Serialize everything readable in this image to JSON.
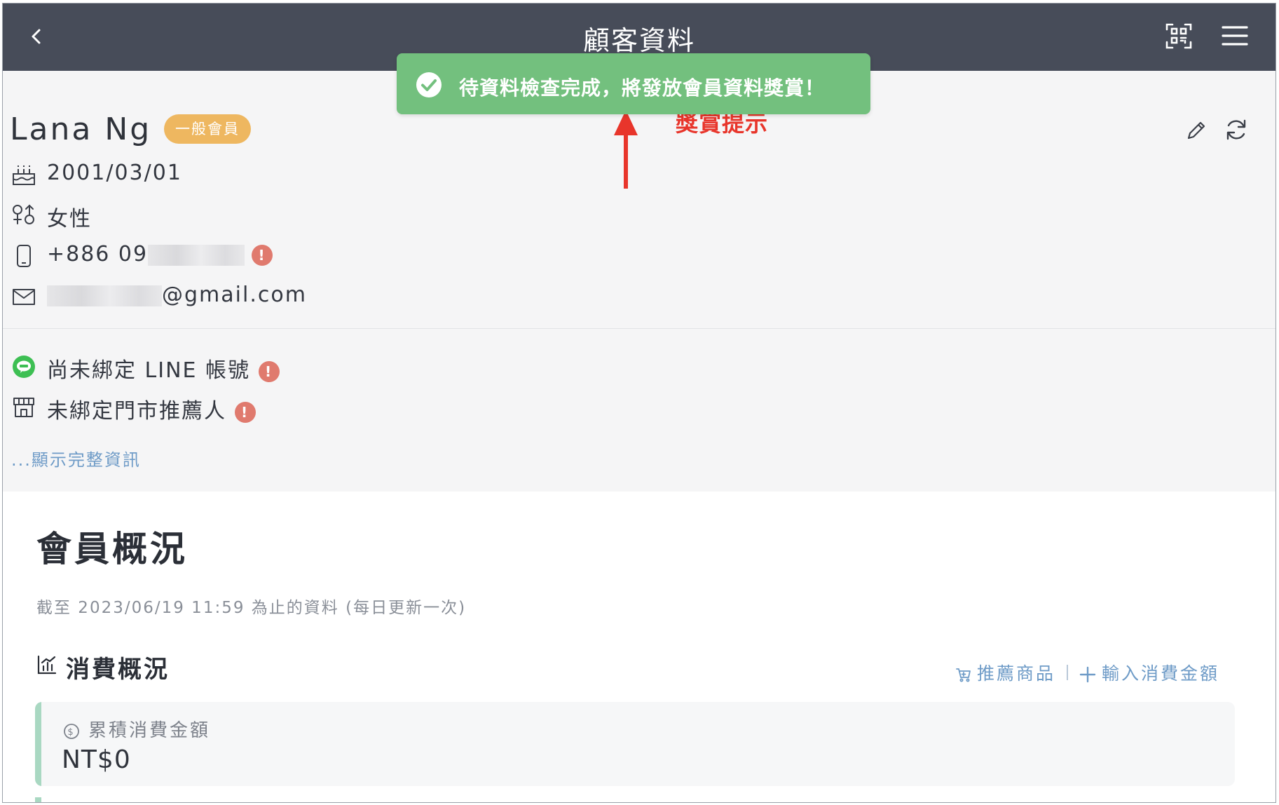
{
  "header": {
    "title": "顧客資料"
  },
  "toast": {
    "message": "待資料檢查完成，將發放會員資料獎賞！",
    "color": "#73c07e"
  },
  "annotation": {
    "label": "獎賞提示",
    "color": "#e8352b"
  },
  "profile": {
    "name": "Lana Ng",
    "badge": "一般會員",
    "birthday": "2001/03/01",
    "gender": "女性",
    "phone_prefix": "+886 09",
    "email_suffix": "@gmail.com",
    "line_status": "尚未綁定 LINE 帳號",
    "store_referrer": "未綁定門市推薦人",
    "show_more": "...顯示完整資訊",
    "warning_symbol": "!"
  },
  "overview": {
    "title": "會員概況",
    "updated_note": "截至 2023/06/19 11:59 為止的資料 (每日更新一次)",
    "spending_title": "消費概況",
    "actions": {
      "recommend": "推薦商品",
      "input_amount": "輸入消費金額"
    },
    "total_spend_label": "累積消費金額",
    "total_spend_value": "NT$0"
  }
}
